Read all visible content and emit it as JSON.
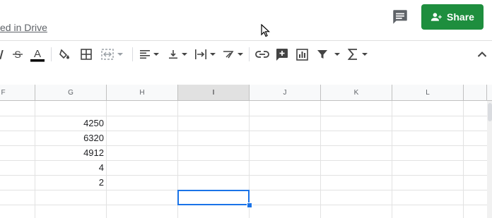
{
  "header": {
    "saved_status": "ed in Drive",
    "share_label": "Share"
  },
  "toolbar": {
    "icons": [
      "strikethrough-icon",
      "text-color-icon",
      "fill-color-icon",
      "borders-icon",
      "merge-cells-icon",
      "horizontal-align-icon",
      "vertical-align-icon",
      "text-wrap-icon",
      "text-rotation-icon",
      "insert-link-icon",
      "insert-comment-icon",
      "insert-chart-icon",
      "filter-icon",
      "functions-icon",
      "collapse-toolbar-icon"
    ],
    "text_color": "#000000"
  },
  "columns": [
    "F",
    "G",
    "H",
    "I",
    "J",
    "K",
    "L"
  ],
  "selected_column": "I",
  "cells_g": [
    "4250",
    "6320",
    "4912",
    "4",
    "2"
  ],
  "colors": {
    "share_green": "#1e8e3e",
    "selection_blue": "#1a73e8",
    "header_bg": "#f8f9fa"
  }
}
